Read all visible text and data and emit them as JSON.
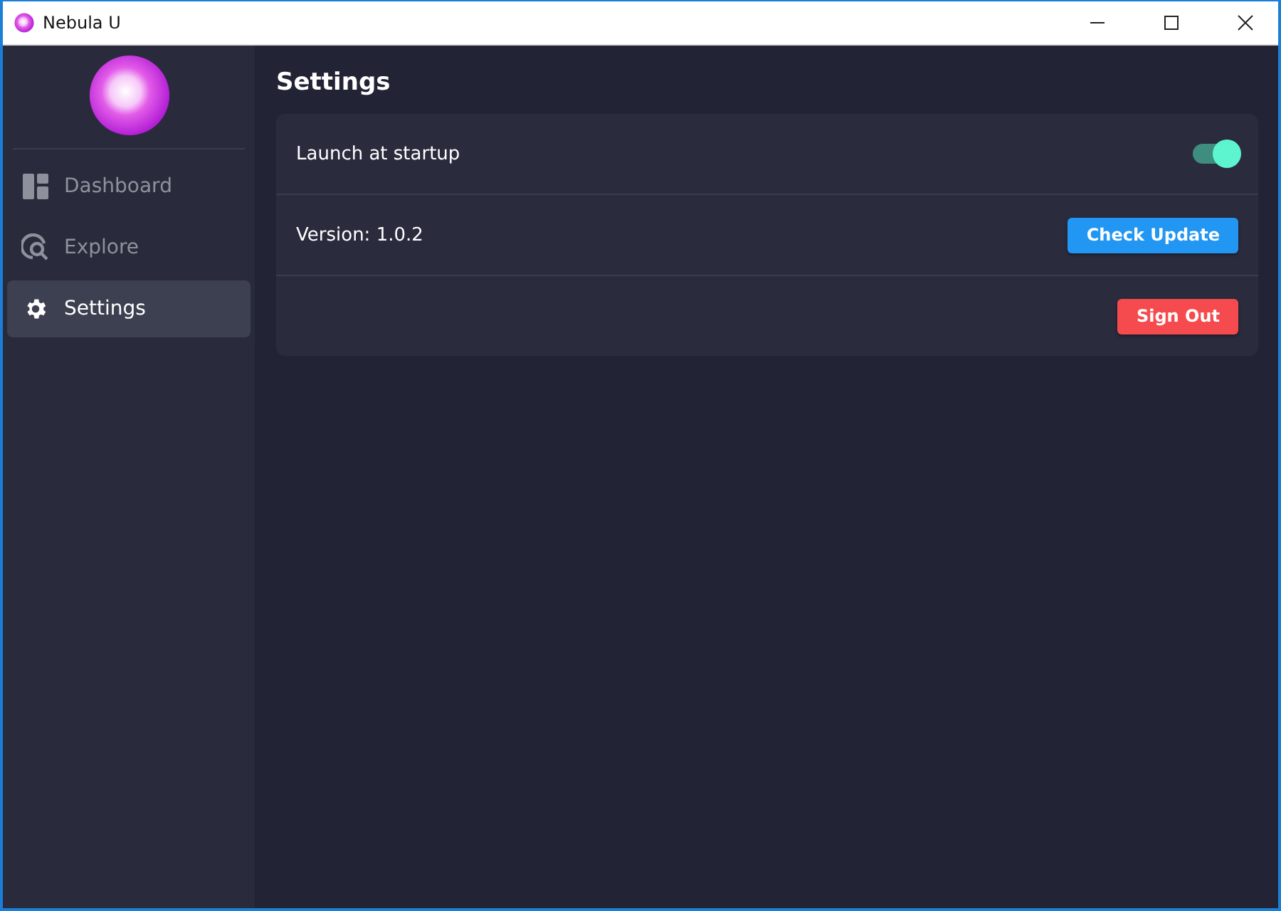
{
  "window": {
    "title": "Nebula U"
  },
  "sidebar": {
    "items": [
      {
        "label": "Dashboard",
        "selected": false
      },
      {
        "label": "Explore",
        "selected": false
      },
      {
        "label": "Settings",
        "selected": true
      }
    ]
  },
  "page": {
    "title": "Settings",
    "rows": [
      {
        "kind": "toggle",
        "label": "Launch at startup",
        "on": true
      },
      {
        "kind": "action",
        "label": "Version: 1.0.2",
        "button": "Check Update"
      },
      {
        "kind": "danger",
        "button": "Sign Out"
      }
    ]
  }
}
